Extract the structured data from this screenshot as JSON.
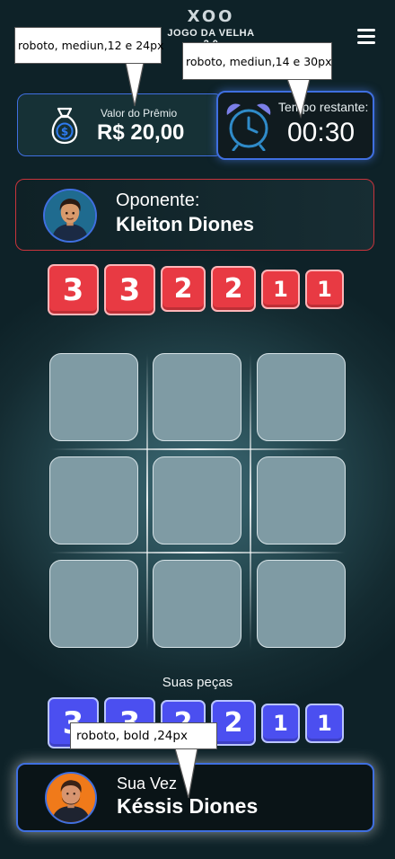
{
  "header": {
    "logo_symbols": "XOO",
    "logo_subtitle": "JOGO DA VELHA 2.0"
  },
  "prize": {
    "label": "Valor do Prêmio",
    "value": "R$ 20,00",
    "icon": "money-bag-icon"
  },
  "timer": {
    "label": "Tempo restante:",
    "value": "00:30",
    "icon": "alarm-clock-icon"
  },
  "opponent": {
    "label": "Oponente:",
    "name": "Kleiton Diones"
  },
  "opponent_pieces": [
    "3",
    "3",
    "2",
    "2",
    "1",
    "1"
  ],
  "my_pieces_label": "Suas peças",
  "my_pieces": [
    "3",
    "3",
    "2",
    "2",
    "1",
    "1"
  ],
  "player": {
    "label": "Sua Vez",
    "name": "Késsis Diones"
  },
  "annotations": {
    "prize_note": "roboto, mediun,12 e 24px",
    "timer_note": "roboto, mediun,14 e 30px",
    "player_note": "roboto, bold ,24px"
  },
  "colors": {
    "accent_blue": "#3f6fe0",
    "piece_red": "#e83a43",
    "piece_blue": "#4b4ff0",
    "cell": "#7f9ba4"
  }
}
